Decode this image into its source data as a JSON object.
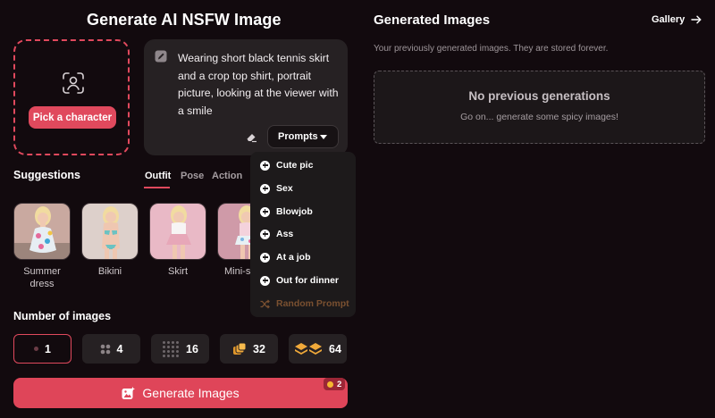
{
  "page_title": "Generate AI NSFW Image",
  "character": {
    "pick_label": "Pick a character",
    "icon": "face-scan-icon"
  },
  "prompt": {
    "text": "Wearing short black tennis skirt and a crop top shirt, portrait picture, looking at the viewer with a smile",
    "prompts_label": "Prompts"
  },
  "prompts_menu": {
    "items": [
      "Cute pic",
      "Sex",
      "Blowjob",
      "Ass",
      "At a job",
      "Out for dinner"
    ],
    "random_label": "Random Prompt"
  },
  "suggestions": {
    "title": "Suggestions",
    "tabs": [
      "Outfit",
      "Pose",
      "Action"
    ],
    "active_tab": "Outfit",
    "items": [
      {
        "label": "Summer dress"
      },
      {
        "label": "Bikini"
      },
      {
        "label": "Skirt"
      },
      {
        "label": "Mini-s"
      }
    ]
  },
  "number_of_images": {
    "title": "Number of images",
    "options": [
      "1",
      "4",
      "16",
      "32",
      "64"
    ],
    "selected": "1"
  },
  "generate": {
    "label": "Generate Images",
    "cost": "2"
  },
  "generated": {
    "title": "Generated Images",
    "gallery_label": "Gallery",
    "subtitle": "Your previously generated images. They are stored forever.",
    "empty_title": "No previous generations",
    "empty_subtitle": "Go on... generate some spicy images!"
  },
  "colors": {
    "accent": "#e0495d",
    "background": "#120a0e",
    "panel": "#262123"
  }
}
